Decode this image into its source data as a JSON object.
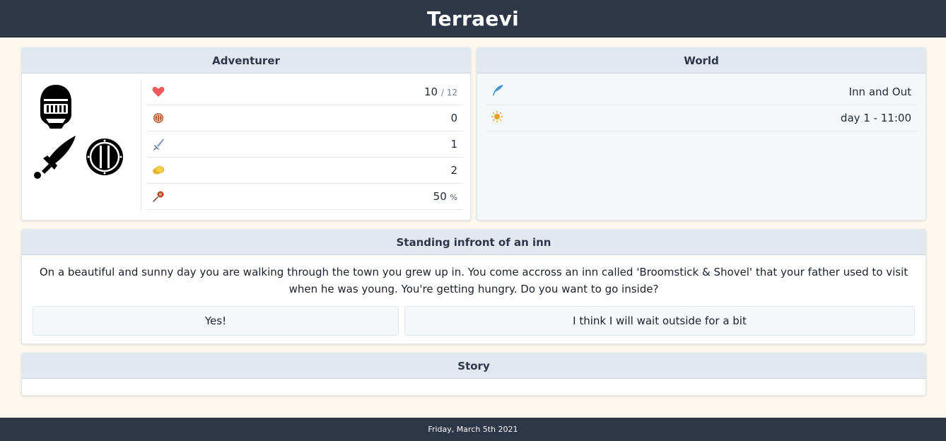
{
  "header": {
    "title": "Terraevi"
  },
  "adventurer": {
    "title": "Adventurer",
    "equipment": [
      {
        "slot": "helmet",
        "icon": "knight-helmet-icon"
      },
      {
        "slot": "weapon",
        "icon": "sword-icon"
      },
      {
        "slot": "shield",
        "icon": "round-shield-icon"
      }
    ],
    "stats": {
      "health": {
        "icon": "heart-icon",
        "value": "10",
        "max": "/ 12"
      },
      "defense": {
        "icon": "shield-icon",
        "value": "0"
      },
      "attack": {
        "icon": "sword-icon",
        "value": "1"
      },
      "gold": {
        "icon": "coins-icon",
        "value": "2"
      },
      "luck": {
        "icon": "torch-icon",
        "value": "50",
        "unit": "%"
      }
    }
  },
  "world": {
    "title": "World",
    "location": {
      "icon": "quill-icon",
      "value": "Inn and Out"
    },
    "time": {
      "icon": "sun-icon",
      "value": "day 1 - 11:00"
    }
  },
  "scene": {
    "title": "Standing infront of an inn",
    "text": "On a beautiful and sunny day you are walking through the town you grew up in. You come accross an inn called 'Broomstick & Shovel' that your father used to visit when he was young. You're getting hungry. Do you want to go inside?",
    "choices": [
      "Yes!",
      "I think I will wait outside for a bit"
    ]
  },
  "story": {
    "title": "Story"
  },
  "footer": {
    "date": "Friday, March 5th 2021"
  },
  "colors": {
    "topbar": "#2d3748",
    "background": "#fdf8ee",
    "card_header": "#e2e8f0",
    "heart": "#f05a5a",
    "gold": "#e8b923"
  }
}
